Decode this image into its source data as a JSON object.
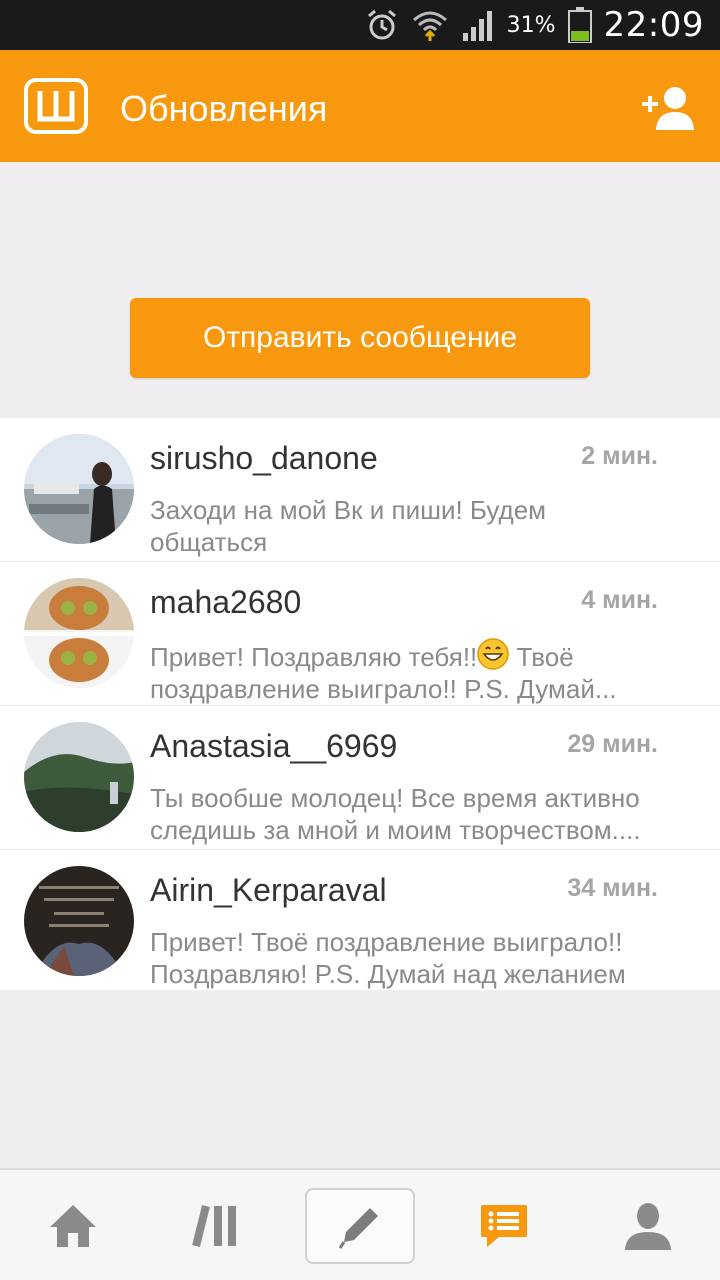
{
  "status_bar": {
    "battery_percent": "31%",
    "clock": "22:09",
    "icons": [
      "alarm-icon",
      "wifi-icon",
      "signal-icon",
      "battery-icon"
    ]
  },
  "app_bar": {
    "logo_icon": "app-logo-icon",
    "title": "Обновления",
    "add_friend_icon": "add-friend-icon"
  },
  "send_message": {
    "label": "Отправить сообщение"
  },
  "messages": [
    {
      "username": "sirusho_danone",
      "time": "2 мин.",
      "preview": "Заходи на мой Вк и пиши! Будем\nобщаться"
    },
    {
      "username": "maha2680",
      "time": "4 мин.",
      "preview_before_emoji": "Привет! Поздравляю тебя!!",
      "preview_after_emoji": " Твоё",
      "preview_line2": "поздравление выиграло!!  P.S. Думай...",
      "emoji_icon": "grinning-face-emoji"
    },
    {
      "username": "Anastasia__6969",
      "time": "29 мин.",
      "preview": "Ты вообше молодец! Все время активно\nследишь за мной и моим творчеством...."
    },
    {
      "username": "Airin_Kerparaval",
      "time": "34 мин.",
      "preview": "Привет! Твоё поздравление выиграло!!\nПоздравляю!  P.S. Думай над желанием"
    }
  ],
  "bottom_nav": {
    "items": [
      "home-icon",
      "feed-icon",
      "compose-icon",
      "messages-icon",
      "profile-icon"
    ],
    "active": "messages-icon"
  },
  "colors": {
    "accent": "#f7980e",
    "nav_icon": "#8a8a8a"
  }
}
